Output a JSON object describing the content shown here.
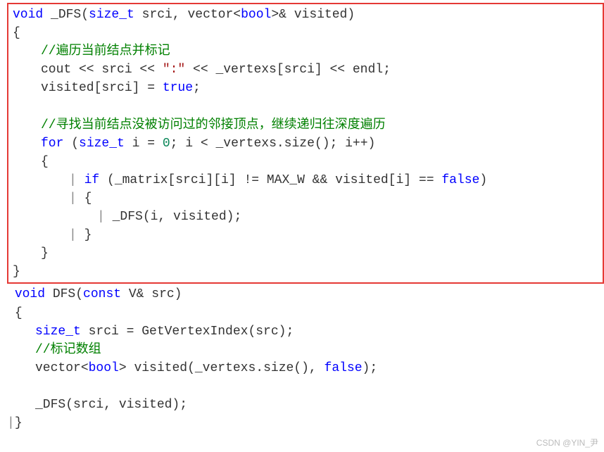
{
  "code": {
    "fn1": {
      "sig_void": "void",
      "sig_name": " _DFS(",
      "sig_sizet": "size_t",
      "sig_srci": " srci, ",
      "sig_vector": "vector",
      "sig_lt": "<",
      "sig_bool": "bool",
      "sig_gt": ">",
      "sig_rest": "& visited)",
      "open_brace": "{",
      "comment1": "//遍历当前结点并标记",
      "l_cout1": "cout << srci << ",
      "l_str1": "\":\"",
      "l_cout2": " << _vertexs[srci] << endl;",
      "l_visit1": "visited[srci] = ",
      "l_true": "true",
      "l_semi1": ";",
      "comment2": "//寻找当前结点没被访问过的邻接顶点，继续递归往深度遍历",
      "for_kw": "for",
      "for_open": " (",
      "for_sizet": "size_t",
      "for_init": " i = ",
      "for_zero": "0",
      "for_cond": "; i < _vertexs.size(); i++)",
      "for_brace_o": "{",
      "if_kw": "if",
      "if_cond1": " (_matrix[srci][i] != MAX_W && visited[i] == ",
      "if_false": "false",
      "if_cond2": ")",
      "if_brace_o": "{",
      "recurse": "_DFS(i, visited);",
      "if_brace_c": "}",
      "for_brace_c": "}",
      "close_brace": "}"
    },
    "fn2": {
      "sig_void": "void",
      "sig_name": " DFS(",
      "sig_const": "const",
      "sig_v": " V",
      "sig_rest": "& src)",
      "open_brace": "{",
      "l_sizet": "size_t",
      "l_srci": " srci = GetVertexIndex(src);",
      "comment3": "//标记数组",
      "l_vector": "vector",
      "l_lt": "<",
      "l_bool": "bool",
      "l_gt": ">",
      "l_visited": " visited(_vertexs.size(), ",
      "l_false": "false",
      "l_end": ");",
      "l_call": "_DFS(srci, visited);",
      "close_brace": "}"
    }
  },
  "watermark": "CSDN @YIN_尹"
}
